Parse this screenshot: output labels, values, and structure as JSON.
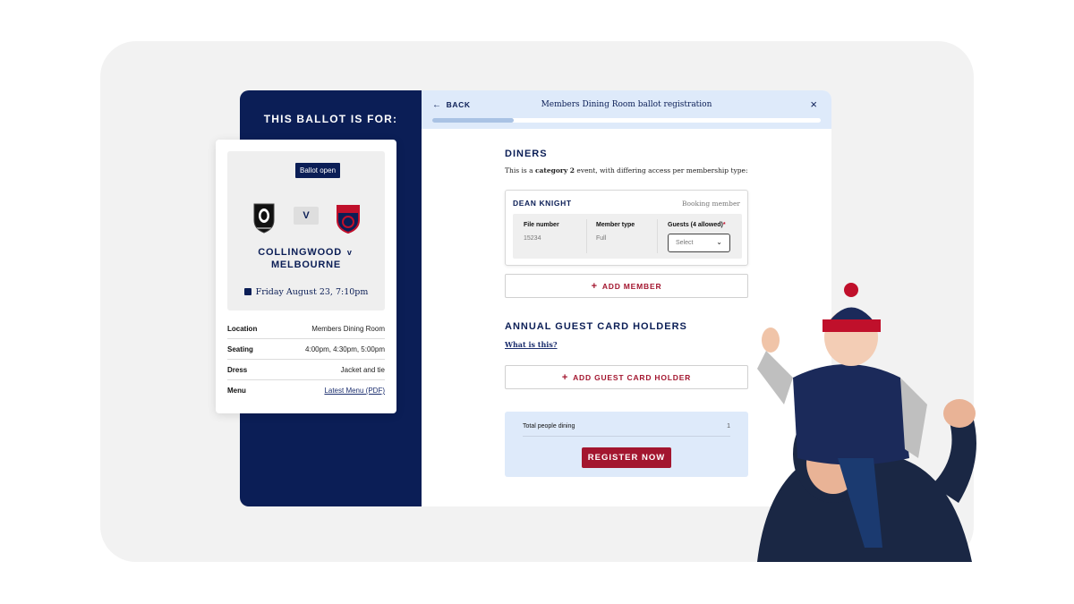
{
  "sidebar": {
    "title": "THIS BALLOT IS FOR:",
    "badge": "Ballot open",
    "home_team": "COLLINGWOOD",
    "separator": "v",
    "away_team": "MELBOURNE",
    "vs_label": "V",
    "date": "Friday August 23, 7:10pm",
    "details": [
      {
        "label": "Location",
        "value": "Members Dining Room"
      },
      {
        "label": "Seating",
        "value": "4:00pm, 4:30pm, 5:00pm"
      },
      {
        "label": "Dress",
        "value": "Jacket and tie"
      },
      {
        "label": "Menu",
        "value": "Latest Menu (PDF)"
      }
    ]
  },
  "header": {
    "back_label": "BACK",
    "title": "Members Dining Room ballot registration",
    "close_label": "×",
    "progress": 0.21
  },
  "diners": {
    "heading": "DINERS",
    "desc_prefix": "This is a ",
    "desc_bold": "category 2",
    "desc_suffix": " event, with differing access per membership type:",
    "member": {
      "name": "DEAN KNIGHT",
      "role": "Booking member",
      "file_label": "File number",
      "file_value": "15234",
      "type_label": "Member type",
      "type_value": "Full",
      "guests_label": "Guests (4 allowed)",
      "guests_required": "*",
      "guests_placeholder": "Select"
    },
    "add_member_label": "ADD MEMBER"
  },
  "guest_cards": {
    "heading": "ANNUAL GUEST CARD HOLDERS",
    "what_link": "What is this?",
    "add_label": "ADD GUEST CARD HOLDER"
  },
  "summary": {
    "total_label": "Total people dining",
    "total_value": "1",
    "register_label": "REGISTER NOW"
  },
  "colors": {
    "navy": "#0b1e56",
    "crimson": "#a3162f",
    "light_blue": "#deeafa"
  },
  "icons": [
    "back-arrow-icon",
    "close-icon",
    "calendar-icon",
    "plus-icon",
    "chevron-down-icon",
    "collingwood-logo",
    "melbourne-logo"
  ]
}
